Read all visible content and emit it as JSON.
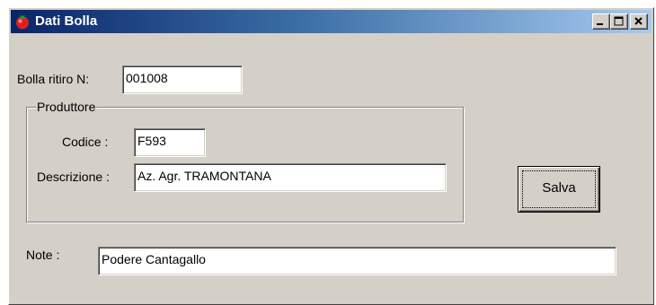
{
  "window": {
    "title": "Dati Bolla",
    "icon": "tomato-icon",
    "controls": [
      "minimize-icon",
      "maximize-icon",
      "close-icon"
    ]
  },
  "form": {
    "bolla_label": "Bolla ritiro N:",
    "bolla_value": "001008",
    "group_label": "Produttore",
    "codice_label": "Codice :",
    "codice_value": "F593",
    "descrizione_label": "Descrizione :",
    "descrizione_value": "Az. Agr.  TRAMONTANA",
    "note_label": "Note :",
    "note_value": "Podere  Cantagallo",
    "save_label": "Salva"
  },
  "colors": {
    "title_start": "#0a246a",
    "title_end": "#a6caf0",
    "face": "#d4d0c8",
    "icon_red": "#e02020",
    "icon_green": "#2a9a2a"
  }
}
